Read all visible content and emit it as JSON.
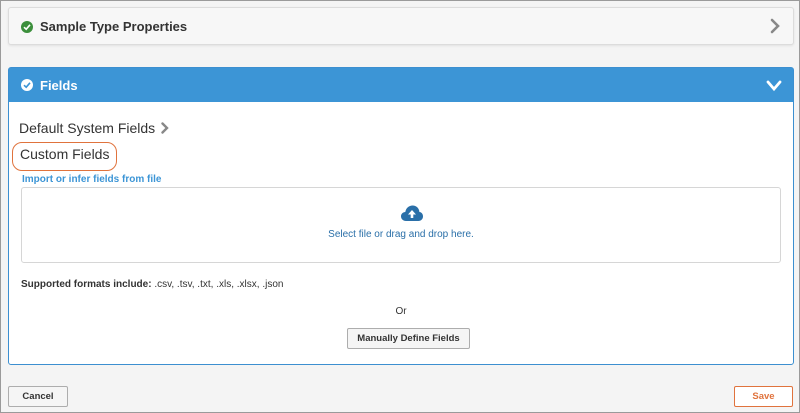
{
  "properties_panel": {
    "title": "Sample Type Properties",
    "status_icon": "check-circle-icon",
    "toggle_icon": "chevron-right-icon"
  },
  "fields_panel": {
    "title": "Fields",
    "status_icon": "check-circle-icon",
    "toggle_icon": "chevron-down-icon",
    "default_fields_label": "Default System Fields",
    "custom_fields_label": "Custom Fields",
    "import_link": "Import or infer fields from file",
    "dropzone_text": "Select file or drag and drop here.",
    "upload_icon": "cloud-upload-icon",
    "formats_label": "Supported formats include:",
    "formats_list": ".csv, .tsv, .txt, .xls, .xlsx, .json",
    "or_text": "Or",
    "manual_button": "Manually Define Fields"
  },
  "footer": {
    "cancel_label": "Cancel",
    "save_label": "Save"
  },
  "colors": {
    "header_blue": "#3c95d6",
    "success_green": "#3c8f3c",
    "accent_orange": "#e0733d",
    "link_blue": "#2a6fa8"
  }
}
